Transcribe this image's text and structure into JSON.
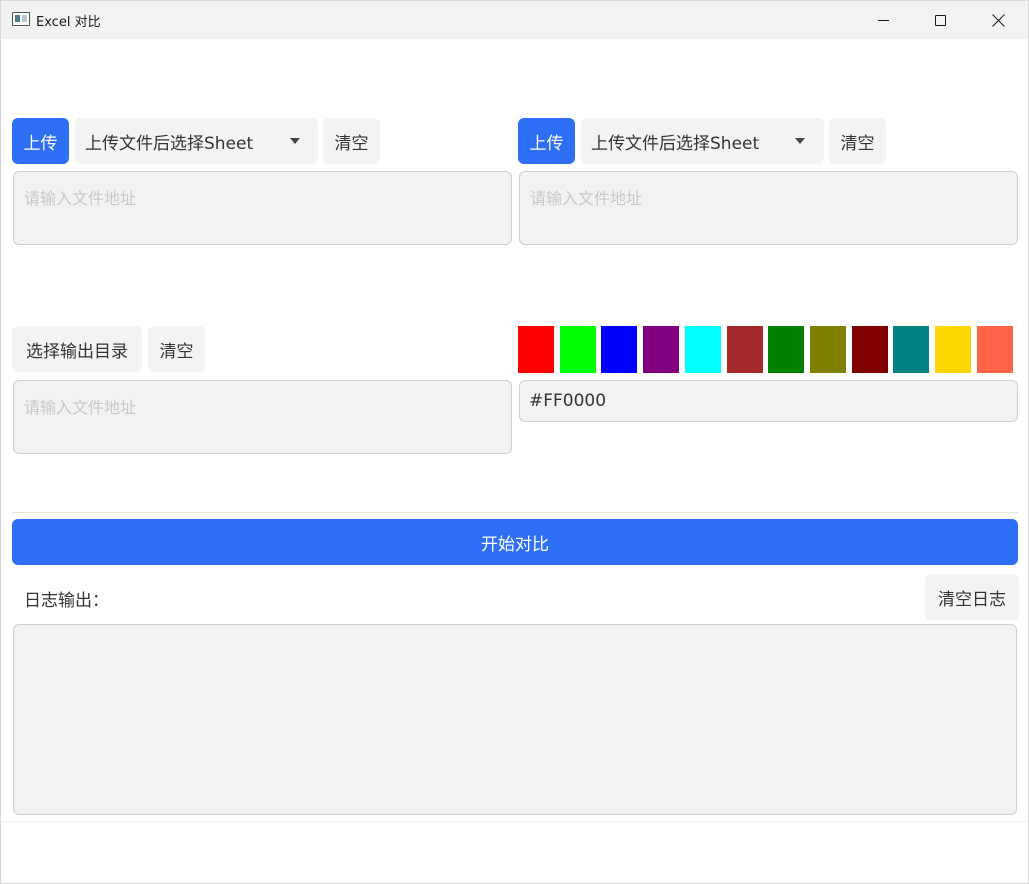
{
  "window": {
    "title": "Excel 对比"
  },
  "left_source": {
    "upload_label": "上传",
    "sheet_select": "上传文件后选择Sheet",
    "clear_label": "清空",
    "path_placeholder": "请输入文件地址"
  },
  "right_source": {
    "upload_label": "上传",
    "sheet_select": "上传文件后选择Sheet",
    "clear_label": "清空",
    "path_placeholder": "请输入文件地址"
  },
  "output": {
    "select_dir_label": "选择输出目录",
    "clear_label": "清空",
    "path_placeholder": "请输入文件地址"
  },
  "color_picker": {
    "swatches": [
      "#FF0000",
      "#00FF00",
      "#0000FF",
      "#800080",
      "#00FFFF",
      "#A52A2A",
      "#008000",
      "#808000",
      "#800000",
      "#008080",
      "#FFD700",
      "#FF6347"
    ],
    "value": "#FF0000"
  },
  "actions": {
    "compare_label": "开始对比"
  },
  "log": {
    "title": "日志输出：",
    "clear_label": "清空日志",
    "content": ""
  },
  "colors": {
    "accent": "#2F6FF5",
    "field_bg": "#F2F2F2"
  }
}
